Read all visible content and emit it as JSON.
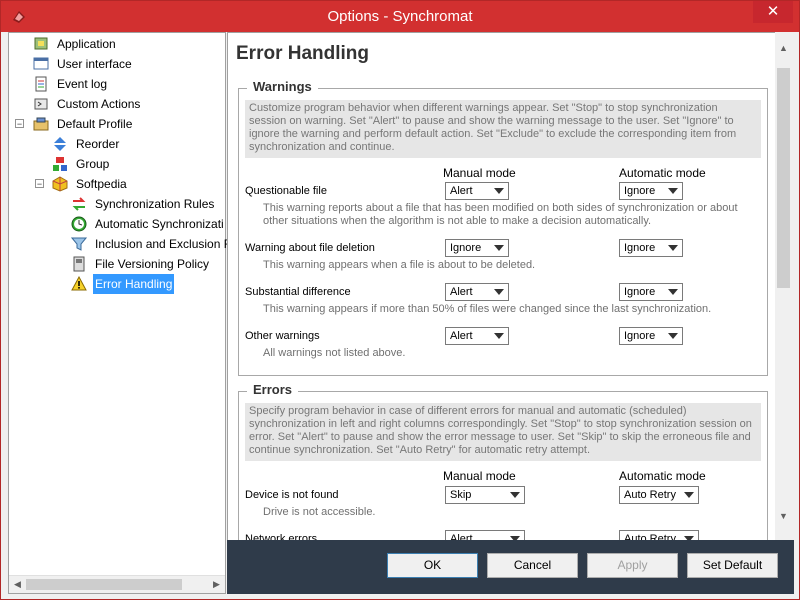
{
  "window": {
    "title": "Options - Synchromat",
    "close_glyph": "✕",
    "app_icon": "synchromat-app-icon"
  },
  "tree": {
    "items": [
      {
        "label": "Application",
        "icon": "application-icon"
      },
      {
        "label": "User interface",
        "icon": "user-interface-icon"
      },
      {
        "label": "Event log",
        "icon": "event-log-icon"
      },
      {
        "label": "Custom Actions",
        "icon": "custom-actions-icon"
      },
      {
        "label": "Default Profile",
        "icon": "profile-icon"
      },
      {
        "label": "Reorder",
        "icon": "reorder-icon"
      },
      {
        "label": "Group",
        "icon": "group-icon"
      },
      {
        "label": "Softpedia",
        "icon": "softpedia-icon"
      },
      {
        "label": "Synchronization Rules",
        "icon": "sync-rules-icon"
      },
      {
        "label": "Automatic Synchronizati",
        "icon": "clock-icon"
      },
      {
        "label": "Inclusion and Exclusion F",
        "icon": "filter-icon"
      },
      {
        "label": "File Versioning Policy",
        "icon": "file-versioning-icon"
      },
      {
        "label": "Error Handling",
        "icon": "warning-icon"
      }
    ]
  },
  "page": {
    "title": "Error Handling"
  },
  "warnings": {
    "title": "Warnings",
    "description": "Customize program behavior when different warnings appear. Set \"Stop\" to stop synchronization session on warning. Set \"Alert\" to pause and show the warning message to the user. Set \"Ignore\" to ignore the warning and perform default action. Set \"Exclude\" to exclude the corresponding item from synchronization and continue.",
    "manual_header": "Manual mode",
    "auto_header": "Automatic mode",
    "rows": [
      {
        "label": "Questionable file",
        "manual": "Alert",
        "auto": "Ignore",
        "description": "This warning reports about a file that has been modified on both sides of synchronization or about other situations when the algorithm is not able to make a decision automatically."
      },
      {
        "label": "Warning about file deletion",
        "manual": "Ignore",
        "auto": "Ignore",
        "description": "This warning appears when a file is about to be deleted."
      },
      {
        "label": "Substantial difference",
        "manual": "Alert",
        "auto": "Ignore",
        "description": "This warning appears if more than 50% of files were changed since the last synchronization."
      },
      {
        "label": "Other warnings",
        "manual": "Alert",
        "auto": "Ignore",
        "description": "All warnings not listed above."
      }
    ]
  },
  "errors": {
    "title": "Errors",
    "description": "Specify program behavior in case of different errors for manual and automatic (scheduled) synchronization in left and right columns correspondingly. Set \"Stop\" to stop synchronization session on error. Set \"Alert\" to pause and show the error message to user. Set \"Skip\" to skip the erroneous file and continue synchronization. Set \"Auto Retry\" for automatic retry attempt.",
    "manual_header": "Manual mode",
    "auto_header": "Automatic mode",
    "rows": [
      {
        "label": "Device is not found",
        "manual": "Skip",
        "auto": "Auto Retry",
        "description": "Drive is not accessible."
      },
      {
        "label": "Network errors",
        "manual": "Alert",
        "auto": "Auto Retry",
        "description": ""
      }
    ]
  },
  "buttons": {
    "ok": "OK",
    "cancel": "Cancel",
    "apply": "Apply",
    "set_default": "Set Default"
  },
  "colors": {
    "titlebar": "#d23030",
    "selection": "#3399ff",
    "button_bar": "#2f3b4a"
  }
}
